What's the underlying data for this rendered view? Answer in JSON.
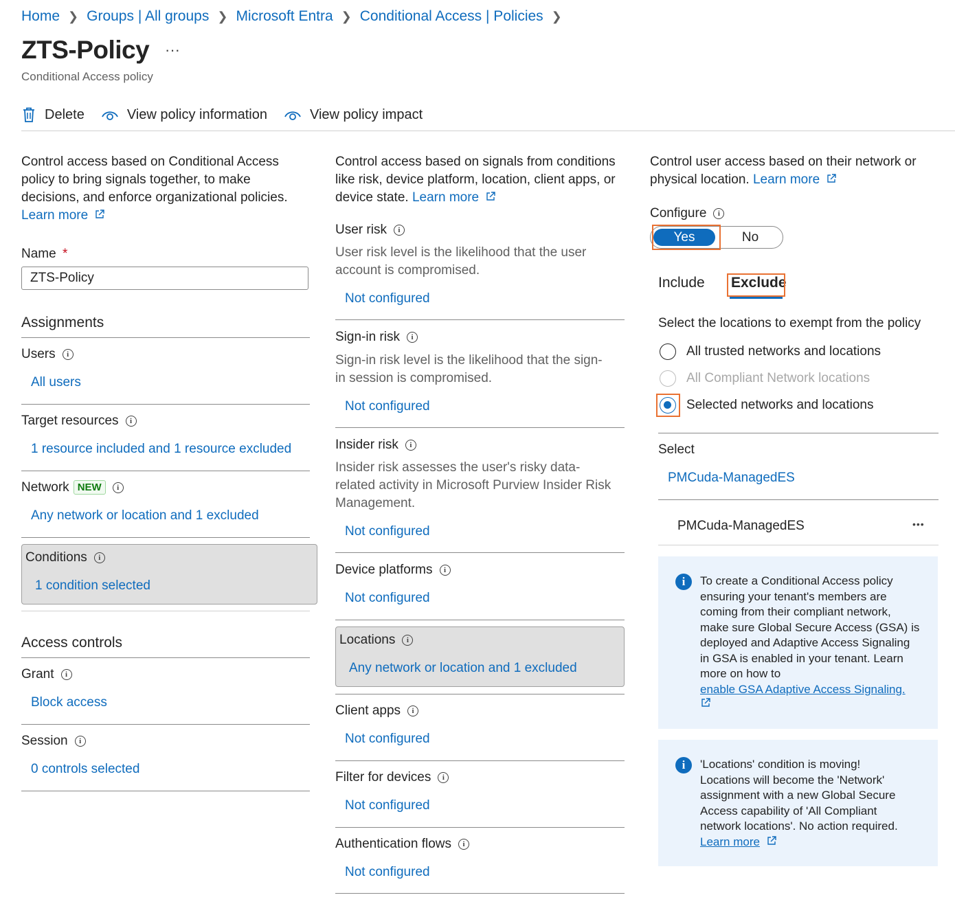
{
  "breadcrumb": [
    "Home",
    "Groups | All groups",
    "Microsoft Entra",
    "Conditional Access | Policies"
  ],
  "page": {
    "title": "ZTS-Policy",
    "more": "···",
    "subtitle": "Conditional Access policy"
  },
  "toolbar": {
    "delete": "Delete",
    "view_info": "View policy information",
    "view_impact": "View policy impact"
  },
  "left": {
    "desc_lines": [
      "Control access based on Conditional Access",
      "policy to bring signals together, to make",
      "decisions, and enforce organizational policies."
    ],
    "learn_more": "Learn more",
    "name_label": "Name",
    "required": "*",
    "name_value": "ZTS-Policy",
    "assignments": "Assignments",
    "users_label": "Users",
    "users_value": "All users",
    "target_label": "Target resources",
    "target_value": "1 resource included and 1 resource excluded",
    "network_label": "Network",
    "network_badge": "NEW",
    "network_value": "Any network or location and 1 excluded",
    "conditions_label": "Conditions",
    "conditions_value": "1 condition selected",
    "access_controls": "Access controls",
    "grant_label": "Grant",
    "grant_value": "Block access",
    "session_label": "Session",
    "session_value": "0 controls selected"
  },
  "middle": {
    "desc_lines": [
      "Control access based on signals from conditions",
      "like risk, device platform, location, client apps, or"
    ],
    "desc_last": "device state.",
    "learn_more": "Learn more",
    "user_risk": "User risk",
    "user_risk_desc": [
      "User risk level is the likelihood that the user",
      "account is compromised."
    ],
    "signin_risk": "Sign-in risk",
    "signin_risk_desc": [
      "Sign-in risk level is the likelihood that the sign-",
      "in session is compromised."
    ],
    "insider_risk": "Insider risk",
    "insider_risk_desc": [
      "Insider risk assesses the user's risky data-",
      "related activity in Microsoft Purview Insider Risk",
      "Management."
    ],
    "device_platforms": "Device platforms",
    "locations": "Locations",
    "locations_value": "Any network or location and 1 excluded",
    "client_apps": "Client apps",
    "filter_devices": "Filter for devices",
    "auth_flows": "Authentication flows",
    "not_configured": "Not configured"
  },
  "right": {
    "desc_lines": [
      "Control user access based on their network or"
    ],
    "desc_last": "physical location.",
    "learn_more": "Learn more",
    "configure_label": "Configure",
    "yes": "Yes",
    "no": "No",
    "tab_include": "Include",
    "tab_exclude": "Exclude",
    "select_prompt": "Select the locations to exempt from the policy",
    "opt_trusted": "All trusted networks and locations",
    "opt_compliant": "All Compliant Network locations",
    "opt_selected": "Selected networks and locations",
    "select_label": "Select",
    "select_value": "PMCuda-ManagedES",
    "selected_item": "PMCuda-ManagedES",
    "item_more": "•••",
    "info1": [
      "To create a Conditional Access policy",
      "ensuring your tenant's members are",
      "coming from their compliant network,",
      "make sure Global Secure Access (GSA) is",
      "deployed and Adaptive Access Signaling",
      "in GSA is enabled in your tenant. Learn",
      "more on how to"
    ],
    "info1_link": "enable GSA Adaptive Access Signaling.",
    "info2": [
      "'Locations' condition is moving!",
      "Locations will become the 'Network'",
      "assignment with a new Global Secure",
      "Access capability of 'All Compliant",
      "network locations'. No action required."
    ],
    "info2_link": "Learn more"
  },
  "colors": {
    "accent": "#0f6cbd",
    "highlight": "#e97132",
    "badge_green": "#107c10",
    "info_bg": "#ebf3fc"
  }
}
